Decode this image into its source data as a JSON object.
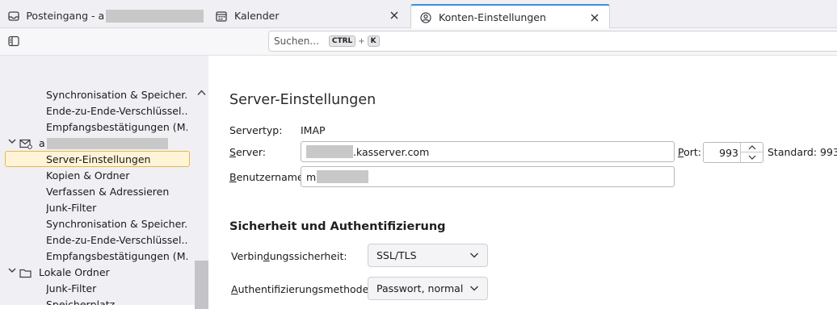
{
  "tabs": [
    {
      "label": "Posteingang - a",
      "icon": "inbox-icon",
      "closable": false
    },
    {
      "label": "Kalender",
      "icon": "calendar-icon",
      "closable": true
    },
    {
      "label": "Konten-Einstellungen",
      "icon": "account-settings-icon",
      "closable": true,
      "active": true
    }
  ],
  "search": {
    "placeholder": "Suchen...",
    "shortcut_keys": [
      "CTRL",
      "K"
    ],
    "shortcut_plus": "+"
  },
  "sidebar": {
    "items_top": [
      "Synchronisation & Speicher...",
      "Ende-zu-Ende-Verschlüssel...",
      "Empfangsbestätigungen (M..."
    ],
    "account_label": "a",
    "account_items": [
      {
        "label": "Server-Einstellungen",
        "selected": true
      },
      {
        "label": "Kopien & Ordner"
      },
      {
        "label": "Verfassen & Adressieren"
      },
      {
        "label": "Junk-Filter"
      },
      {
        "label": "Synchronisation & Speicher..."
      },
      {
        "label": "Ende-zu-Ende-Verschlüssel..."
      },
      {
        "label": "Empfangsbestätigungen (M..."
      }
    ],
    "local_folders": {
      "label": "Lokale Ordner",
      "items": [
        "Junk-Filter",
        "Speicherplatz"
      ]
    }
  },
  "main": {
    "title": "Server-Einstellungen",
    "servertype_label": "Servertyp:",
    "servertype_value": "IMAP",
    "server_label_pre": "",
    "server_label_u": "S",
    "server_label_post": "erver:",
    "server_value": ".kasserver.com",
    "port_label_u": "P",
    "port_label_post": "ort:",
    "port_value": "993",
    "port_default": "Standard: 993",
    "username_label_u": "B",
    "username_label_post": "enutzername:",
    "username_value": "m",
    "security_section": "Sicherheit und Authentifizierung",
    "conn_security_label_pre": "Verbin",
    "conn_security_label_u": "d",
    "conn_security_label_post": "ungssicherheit:",
    "conn_security_value": "SSL/TLS",
    "auth_label_pre": "",
    "auth_label_u": "A",
    "auth_label_post": "uthentifizierungsmethode:",
    "auth_value": "Passwort, normal"
  }
}
